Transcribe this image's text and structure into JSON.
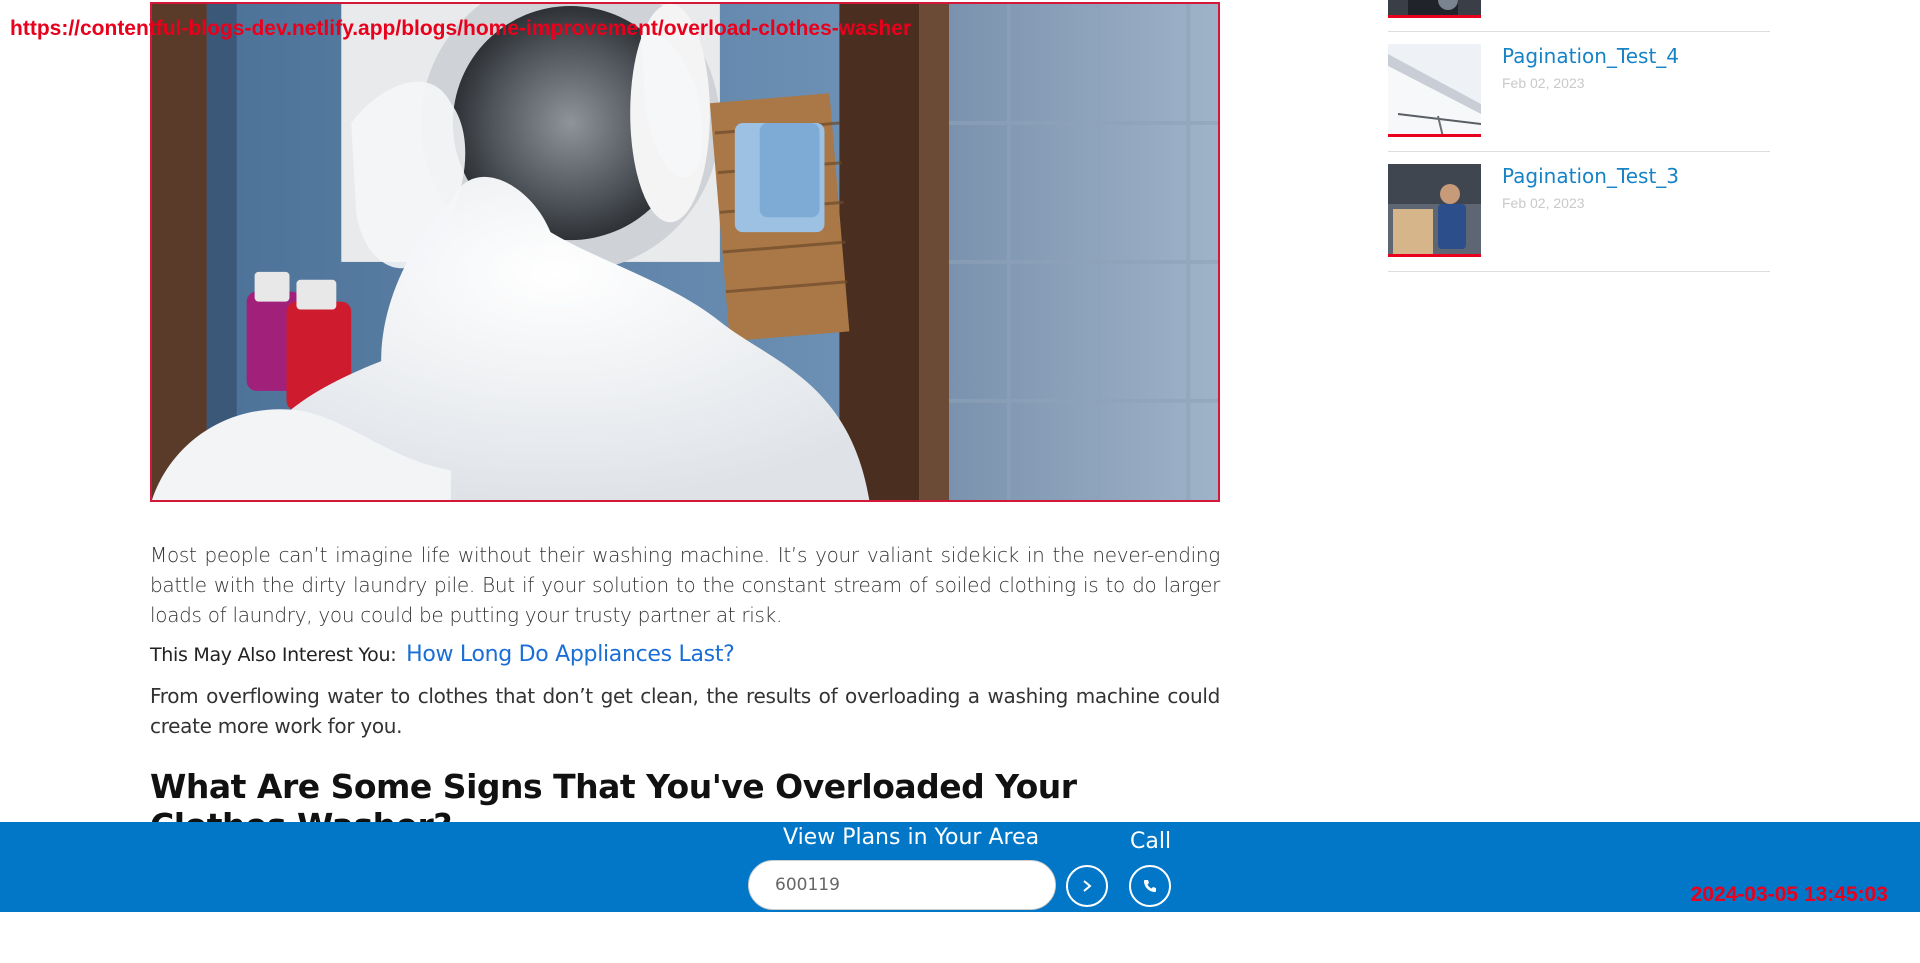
{
  "overlay": {
    "url": "https://contentful-blogs-dev.netlify.app/blogs/home-improvement/overload-clothes-washer",
    "timestamp": "2024-03-05 13:45:03"
  },
  "article": {
    "paragraph1": "Most people can’t imagine life without their washing machine. It’s your valiant sidekick in the never-ending battle with the dirty laundry pile. But if your solution to the constant stream of soiled clothing is to do larger loads of laundry, you could be putting your trusty partner at risk.",
    "interest_label": "This May Also Interest You:",
    "interest_link": "How Long Do Appliances Last?",
    "paragraph2": "From overflowing water to clothes that don’t get clean, the results of overloading a washing machine could create more work for you.",
    "heading": "What Are Some Signs That You've Overloaded Your Clothes Washer?"
  },
  "sidebar": {
    "items": [
      {
        "title": "",
        "date": ""
      },
      {
        "title": "Pagination_Test_4",
        "date": "Feb 02, 2023"
      },
      {
        "title": "Pagination_Test_3",
        "date": "Feb 02, 2023"
      }
    ]
  },
  "footer": {
    "plans_label": "View Plans in Your Area",
    "zip_value": "600119",
    "call_label": "Call"
  },
  "colors": {
    "brand_blue": "#0277c8",
    "link_blue": "#1a6fd6",
    "accent_red": "#e8001c"
  }
}
